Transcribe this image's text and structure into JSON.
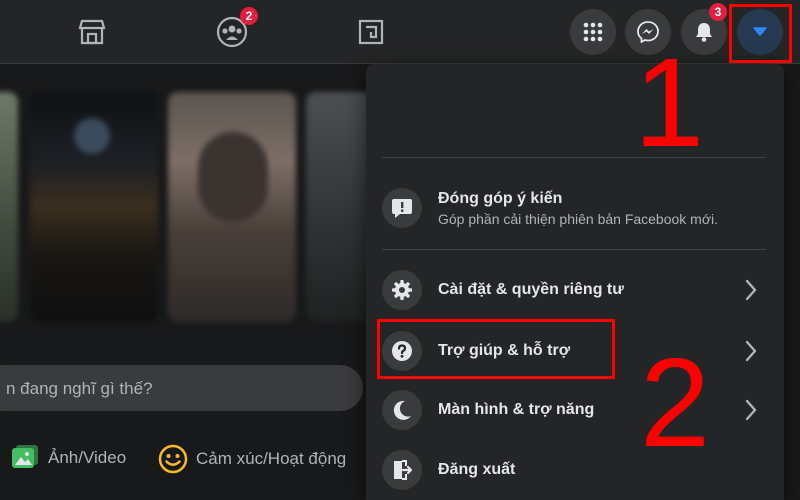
{
  "nav": {
    "groups_badge": "2",
    "notifications_badge": "3"
  },
  "composer": {
    "placeholder": "n đang nghĩ gì thế?"
  },
  "actions": {
    "photo_video": "Ảnh/Video",
    "feeling_activity": "Cảm xúc/Hoạt động"
  },
  "menu": {
    "feedback": {
      "title": "Đóng góp ý kiến",
      "subtitle": "Góp phần cải thiện phiên bản Facebook mới."
    },
    "settings": "Cài đặt & quyền riêng tư",
    "help": "Trợ giúp & hỗ trợ",
    "display": "Màn hình & trợ năng",
    "logout": "Đăng xuất"
  },
  "annotations": {
    "step1": "1",
    "step2": "2"
  },
  "colors": {
    "highlight": "#ff0000",
    "accent": "#2d88ff",
    "badge": "#e41e3f"
  }
}
